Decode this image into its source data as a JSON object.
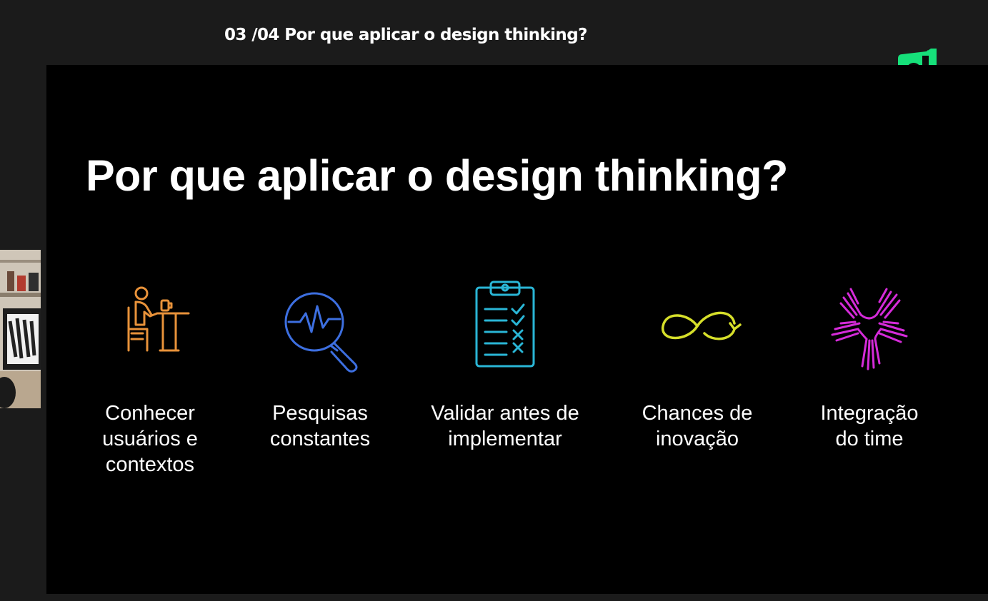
{
  "header": {
    "title": "03 /04 Por que aplicar o design thinking?"
  },
  "brand": {
    "logo_icon": "d-logo-icon",
    "color": "#16e07a"
  },
  "slide": {
    "title": "Por que aplicar o design thinking?",
    "items": [
      {
        "icon": "person-at-desk-icon",
        "color": "#e8923a",
        "label": "Conhecer\nusuários e\ncontextos"
      },
      {
        "icon": "magnifier-pulse-icon",
        "color": "#3d6fe0",
        "label": "Pesquisas\nconstantes"
      },
      {
        "icon": "clipboard-checklist-icon",
        "color": "#2ab6d6",
        "label": "Validar antes de\nimplementar"
      },
      {
        "icon": "infinity-loop-icon",
        "color": "#d6df2a",
        "label": "Chances de\ninovação"
      },
      {
        "icon": "hands-together-icon",
        "color": "#d52bd9",
        "label": "Integração\ndo time"
      }
    ]
  }
}
